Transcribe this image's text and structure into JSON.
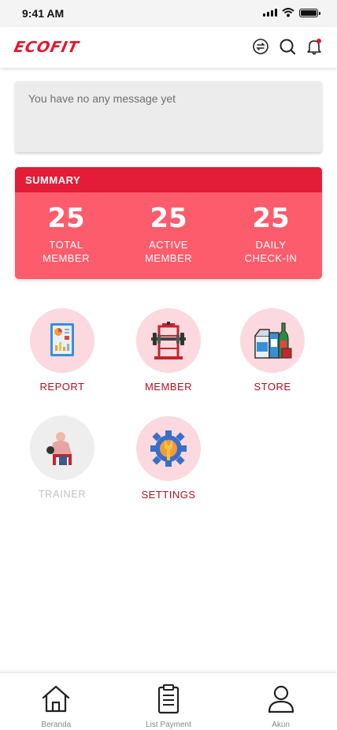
{
  "status_bar": {
    "time": "9:41 AM"
  },
  "header": {
    "logo": "ECOFIT",
    "icons": [
      "sync-icon",
      "search-icon",
      "bell-icon"
    ],
    "accent_color": "#e3172f"
  },
  "message": {
    "text": "You have no any message yet"
  },
  "summary": {
    "title": "SUMMARY",
    "stats": [
      {
        "value": "25",
        "label_line1": "TOTAL",
        "label_line2": "MEMBER"
      },
      {
        "value": "25",
        "label_line1": "ACTIVE",
        "label_line2": "MEMBER"
      },
      {
        "value": "25",
        "label_line1": "DAILY",
        "label_line2": "CHECK-IN"
      }
    ],
    "header_color": "#e31c38",
    "body_color": "#fc5c6c"
  },
  "menu": [
    {
      "label": "REPORT",
      "icon": "report-icon",
      "enabled": true
    },
    {
      "label": "MEMBER",
      "icon": "barbell-icon",
      "enabled": true
    },
    {
      "label": "STORE",
      "icon": "store-icon",
      "enabled": true
    },
    {
      "label": "TRAINER",
      "icon": "trainer-icon",
      "enabled": false
    },
    {
      "label": "SETTINGS",
      "icon": "settings-gear-icon",
      "enabled": true
    }
  ],
  "bottom_nav": [
    {
      "label": "Beranda",
      "icon": "home-icon"
    },
    {
      "label": "List Payment",
      "icon": "clipboard-icon"
    },
    {
      "label": "Akun",
      "icon": "user-icon"
    }
  ]
}
